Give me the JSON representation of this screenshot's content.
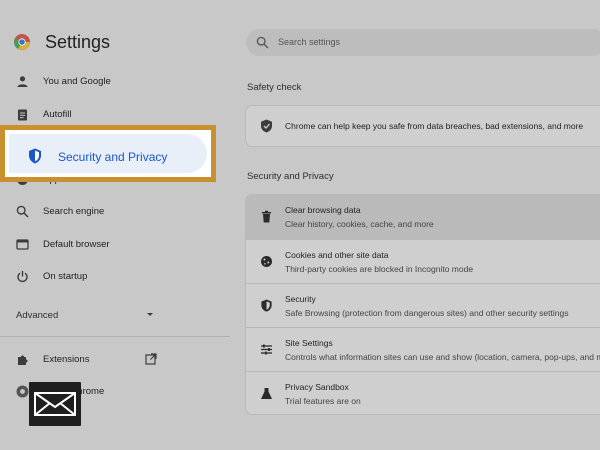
{
  "header": {
    "title": "Settings",
    "search_placeholder": "Search settings"
  },
  "sidebar": {
    "items": [
      {
        "label": "You and Google",
        "icon": "person-icon"
      },
      {
        "label": "Autofill",
        "icon": "clipboard-icon"
      },
      {
        "label": "Security and Privacy",
        "icon": "shield-icon"
      },
      {
        "label": "Appearance",
        "icon": "palette-icon"
      },
      {
        "label": "Search engine",
        "icon": "search-icon"
      },
      {
        "label": "Default browser",
        "icon": "browser-icon"
      },
      {
        "label": "On startup",
        "icon": "power-icon"
      }
    ],
    "advanced_label": "Advanced",
    "extensions_label": "Extensions",
    "about_label": "About Chrome"
  },
  "main": {
    "safety_check": {
      "title": "Safety check",
      "text": "Chrome can help keep you safe from data breaches, bad extensions, and more"
    },
    "security_privacy": {
      "title": "Security and Privacy",
      "rows": [
        {
          "title": "Clear browsing data",
          "desc": "Clear history, cookies, cache, and more",
          "icon": "trash-icon"
        },
        {
          "title": "Cookies and other site data",
          "desc": "Third-party cookies are blocked in Incognito mode",
          "icon": "cookie-icon"
        },
        {
          "title": "Security",
          "desc": "Safe Browsing (protection from dangerous sites) and other security settings",
          "icon": "shield-icon"
        },
        {
          "title": "Site Settings",
          "desc": "Controls what information sites can use and show (location, camera, pop-ups, and more)",
          "icon": "sliders-icon"
        },
        {
          "title": "Privacy Sandbox",
          "desc": "Trial features are on",
          "icon": "flask-icon"
        }
      ]
    }
  },
  "colors": {
    "highlight_border": "#c8902f",
    "highlight_text": "#1a57c8",
    "page_overlay": "#c8c8c8"
  }
}
